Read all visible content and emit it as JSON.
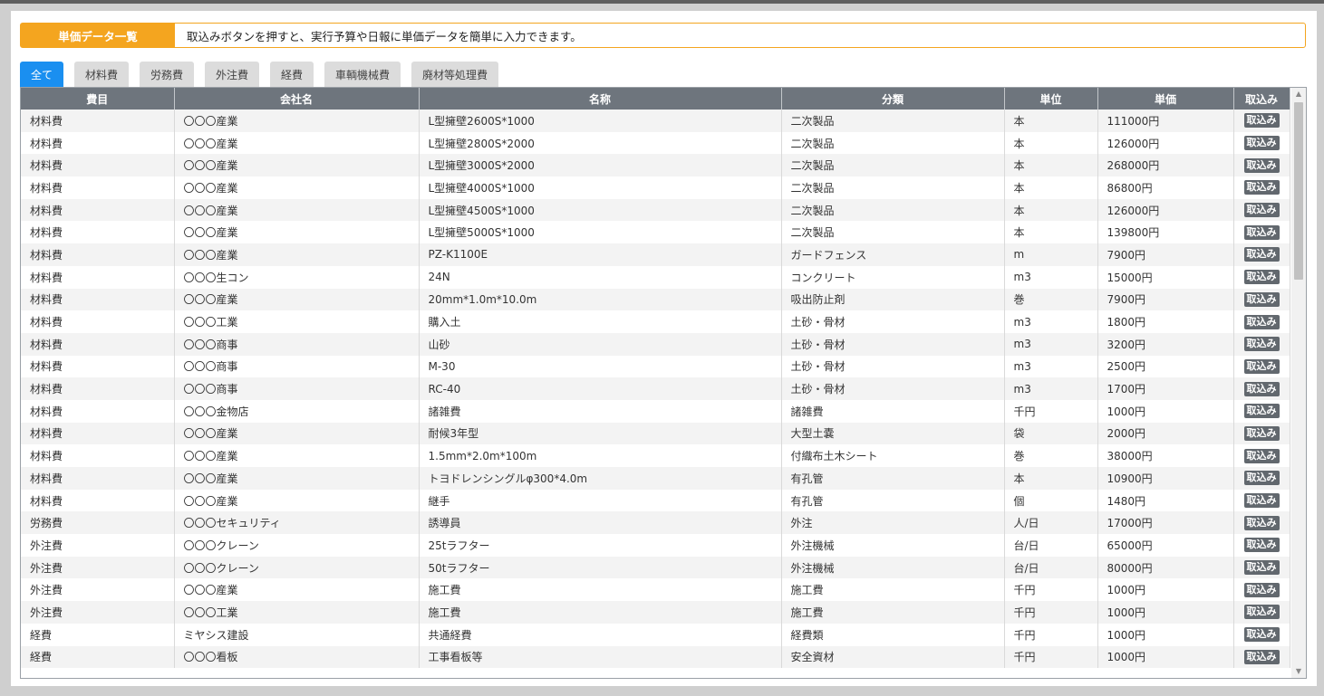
{
  "header": {
    "title": "単価データ一覧",
    "description": "取込みボタンを押すと、実行予算や日報に単価データを簡単に入力できます。"
  },
  "tabs": [
    "全て",
    "材料費",
    "労務費",
    "外注費",
    "経費",
    "車輌機械費",
    "廃材等処理費"
  ],
  "table": {
    "columns": [
      "費目",
      "会社名",
      "名称",
      "分類",
      "単位",
      "単価",
      "取込み"
    ],
    "button_label": "取込み",
    "rows": [
      [
        "材料費",
        "〇〇〇産業",
        "L型擁壁2600S*1000",
        "二次製品",
        "本",
        "111000円"
      ],
      [
        "材料費",
        "〇〇〇産業",
        "L型擁壁2800S*2000",
        "二次製品",
        "本",
        "126000円"
      ],
      [
        "材料費",
        "〇〇〇産業",
        "L型擁壁3000S*2000",
        "二次製品",
        "本",
        "268000円"
      ],
      [
        "材料費",
        "〇〇〇産業",
        "L型擁壁4000S*1000",
        "二次製品",
        "本",
        "86800円"
      ],
      [
        "材料費",
        "〇〇〇産業",
        "L型擁壁4500S*1000",
        "二次製品",
        "本",
        "126000円"
      ],
      [
        "材料費",
        "〇〇〇産業",
        "L型擁壁5000S*1000",
        "二次製品",
        "本",
        "139800円"
      ],
      [
        "材料費",
        "〇〇〇産業",
        "PZ-K1100E",
        "ガードフェンス",
        "m",
        "7900円"
      ],
      [
        "材料費",
        "〇〇〇生コン",
        "24N",
        "コンクリート",
        "m3",
        "15000円"
      ],
      [
        "材料費",
        "〇〇〇産業",
        "20mm*1.0m*10.0m",
        "吸出防止剤",
        "巻",
        "7900円"
      ],
      [
        "材料費",
        "〇〇〇工業",
        "購入土",
        "土砂・骨材",
        "m3",
        "1800円"
      ],
      [
        "材料費",
        "〇〇〇商事",
        "山砂",
        "土砂・骨材",
        "m3",
        "3200円"
      ],
      [
        "材料費",
        "〇〇〇商事",
        "M-30",
        "土砂・骨材",
        "m3",
        "2500円"
      ],
      [
        "材料費",
        "〇〇〇商事",
        "RC-40",
        "土砂・骨材",
        "m3",
        "1700円"
      ],
      [
        "材料費",
        "〇〇〇金物店",
        "諸雑費",
        "諸雑費",
        "千円",
        "1000円"
      ],
      [
        "材料費",
        "〇〇〇産業",
        "耐候3年型",
        "大型土嚢",
        "袋",
        "2000円"
      ],
      [
        "材料費",
        "〇〇〇産業",
        "1.5mm*2.0m*100m",
        "付織布土木シート",
        "巻",
        "38000円"
      ],
      [
        "材料費",
        "〇〇〇産業",
        "トヨドレンシングルφ300*4.0m",
        "有孔管",
        "本",
        "10900円"
      ],
      [
        "材料費",
        "〇〇〇産業",
        "継手",
        "有孔管",
        "個",
        "1480円"
      ],
      [
        "労務費",
        "〇〇〇セキュリティ",
        "誘導員",
        "外注",
        "人/日",
        "17000円"
      ],
      [
        "外注費",
        "〇〇〇クレーン",
        "25tラフター",
        "外注機械",
        "台/日",
        "65000円"
      ],
      [
        "外注費",
        "〇〇〇クレーン",
        "50tラフター",
        "外注機械",
        "台/日",
        "80000円"
      ],
      [
        "外注費",
        "〇〇〇産業",
        "施工費",
        "施工費",
        "千円",
        "1000円"
      ],
      [
        "外注費",
        "〇〇〇工業",
        "施工費",
        "施工費",
        "千円",
        "1000円"
      ],
      [
        "経費",
        "ミヤシス建設",
        "共通経費",
        "経費類",
        "千円",
        "1000円"
      ],
      [
        "経費",
        "〇〇〇看板",
        "工事看板等",
        "安全資材",
        "千円",
        "1000円"
      ]
    ]
  }
}
